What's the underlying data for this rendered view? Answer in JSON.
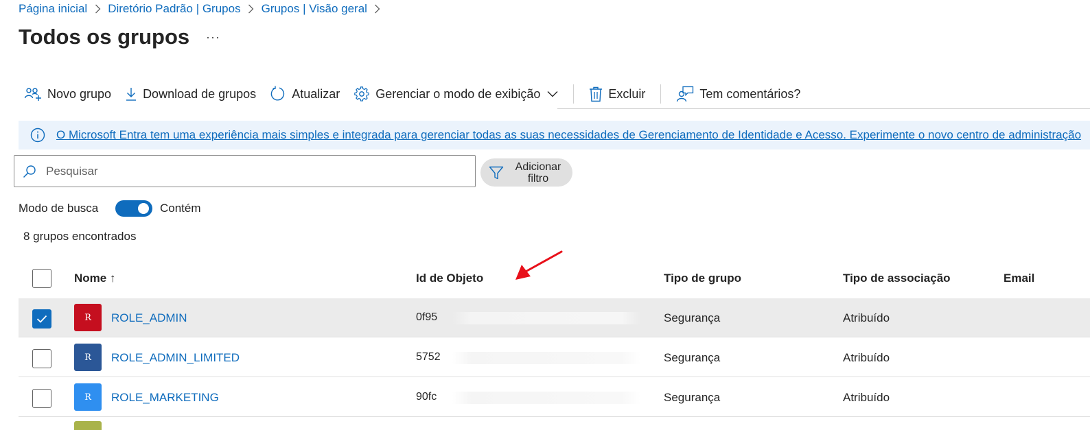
{
  "breadcrumb": [
    {
      "label": "Página inicial"
    },
    {
      "label": "Diretório Padrão | Grupos"
    },
    {
      "label": "Grupos | Visão geral"
    }
  ],
  "page": {
    "title": "Todos os grupos",
    "more_label": "···"
  },
  "toolbar": {
    "new_group": "Novo grupo",
    "download": "Download de grupos",
    "refresh": "Atualizar",
    "manage_view": "Gerenciar o modo de exibição",
    "delete": "Excluir",
    "feedback": "Tem comentários?"
  },
  "banner": {
    "text": "O Microsoft Entra tem uma experiência mais simples e integrada para gerenciar todas as suas necessidades de Gerenciamento de Identidade e Acesso. Experimente o novo centro de administração"
  },
  "search": {
    "placeholder": "Pesquisar",
    "value": ""
  },
  "filter": {
    "label": "Adicionar filtro"
  },
  "search_mode": {
    "label": "Modo de busca",
    "value": "Contém",
    "enabled": true
  },
  "results": {
    "count_label": "8 grupos encontrados"
  },
  "table": {
    "columns": {
      "name": "Nome ↑",
      "object_id": "Id de Objeto",
      "group_type": "Tipo de grupo",
      "membership_type": "Tipo de associação",
      "email": "Email"
    },
    "rows": [
      {
        "initial": "R",
        "name": "ROLE_ADMIN",
        "object_id": "0f95",
        "group_type": "Segurança",
        "membership_type": "Atribuído",
        "avatar_color": "#c50f1f",
        "selected": true
      },
      {
        "initial": "R",
        "name": "ROLE_ADMIN_LIMITED",
        "object_id": "5752",
        "group_type": "Segurança",
        "membership_type": "Atribuído",
        "avatar_color": "#2b5797",
        "selected": false
      },
      {
        "initial": "R",
        "name": "ROLE_MARKETING",
        "object_id": "90fc",
        "group_type": "Segurança",
        "membership_type": "Atribuído",
        "avatar_color": "#2f8ff0",
        "selected": false
      }
    ]
  },
  "colors": {
    "accent": "#0f6cbd",
    "banner_bg": "#ebf3fc",
    "selected_row_bg": "#ebebeb",
    "annotation_arrow": "#e8101a"
  }
}
